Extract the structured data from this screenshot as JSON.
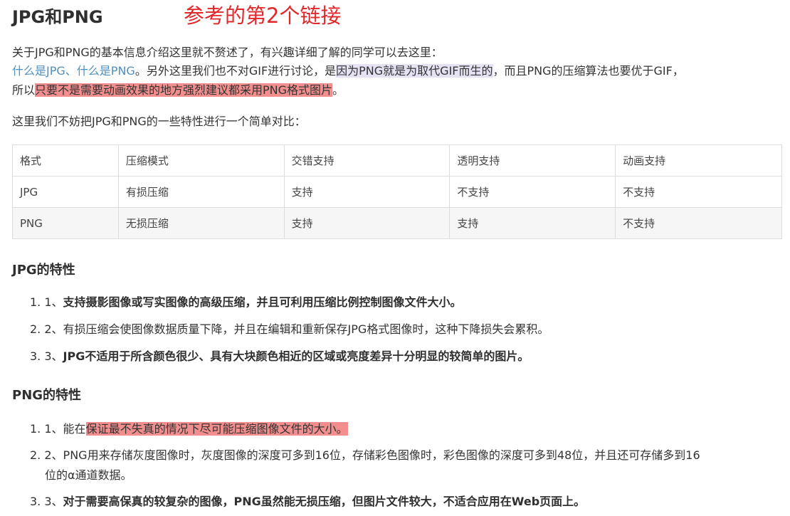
{
  "title": "JPG和PNG",
  "annotation": "参考的第2个链接",
  "intro": {
    "line1": "关于JPG和PNG的基本信息介绍这里就不赘述了，有兴趣详细了解的同学可以去这里：",
    "link1": "什么是JPG",
    "sep": "、",
    "link2": "什么是PNG",
    "mid": "。另外这里我们也不对GIF进行讨论，是",
    "hl1": "因为PNG就是为取代GIF而生的",
    "tail": "，而且PNG的压缩算法也要优于GIF，",
    "line3a": "所以",
    "hl2": "只要不是需要动画效果的地方强烈建议都采用PNG格式图片",
    "line3b": "。"
  },
  "compare_intro": "这里我们不妨把JPG和PNG的一些特性进行一个简单对比：",
  "table": {
    "headers": [
      "格式",
      "压缩模式",
      "交错支持",
      "透明支持",
      "动画支持"
    ],
    "rows": [
      [
        "JPG",
        "有损压缩",
        "支持",
        "不支持",
        "不支持"
      ],
      [
        "PNG",
        "无损压缩",
        "支持",
        "支持",
        "不支持"
      ]
    ]
  },
  "jpg_section": {
    "heading": "JPG的特性",
    "items": [
      {
        "num": "1.",
        "prefix": "1、",
        "text": "支持摄影图像或写实图像的高级压缩，并且可利用压缩比例控制图像文件大小。"
      },
      {
        "num": "2.",
        "prefix": "2、",
        "text": "有损压缩会使图像数据质量下降，并且在编辑和重新保存JPG格式图像时，这种下降损失会累积。"
      },
      {
        "num": "3.",
        "prefix": "3、",
        "text": "JPG不适用于所含颜色很少、具有大块颜色相近的区域或亮度差异十分明显的较简单的图片。"
      }
    ]
  },
  "png_section": {
    "heading": "PNG的特性",
    "items": [
      {
        "num": "1.",
        "prefix": "1、",
        "lead": "能在",
        "hl": "保证最不失真的情况下尽可能压缩图像文件的大小。"
      },
      {
        "num": "2.",
        "prefix": "2、",
        "line1": "PNG用来存储灰度图像时，灰度图像的深度可多到16位，存储彩色图像时，彩色图像的深度可多到48位，并且还可存储多到16",
        "line2": "位的α通道数据。"
      },
      {
        "num": "3.",
        "prefix": "3、",
        "text": "对于需要高保真的较复杂的图像，PNG虽然能无损压缩，但图片文件较大，不适合应用在Web页面上。"
      }
    ]
  },
  "colors": {
    "link": "#4f8fc0",
    "highlight_red": "#f28e8e",
    "highlight_purple": "#e6e2f4",
    "annotation": "#e0282b"
  }
}
